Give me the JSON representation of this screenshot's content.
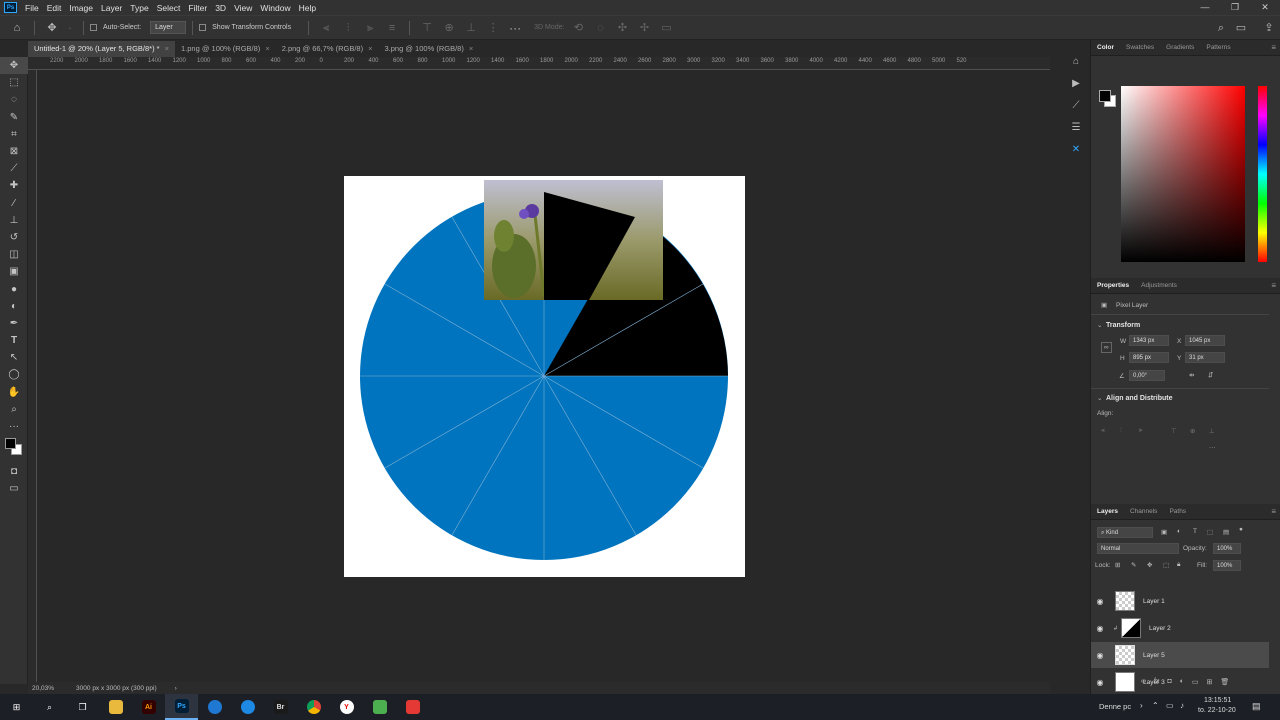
{
  "menu": [
    "File",
    "Edit",
    "Image",
    "Layer",
    "Type",
    "Select",
    "Filter",
    "3D",
    "View",
    "Window",
    "Help"
  ],
  "app_logo": "Ps",
  "window_controls": [
    "—",
    "❐",
    "✕"
  ],
  "options": {
    "auto_select_label": "Auto-Select:",
    "auto_select_value": "Layer",
    "show_transform_label": "Show Transform Controls",
    "mode_3d_label": "3D Mode:"
  },
  "tabs": [
    {
      "label": "Untitled-1 @ 20% (Layer 5, RGB/8*) *",
      "active": true
    },
    {
      "label": "1.png @ 100% (RGB/8)",
      "active": false
    },
    {
      "label": "2.png @ 66,7% (RGB/8)",
      "active": false
    },
    {
      "label": "3.png @ 100% (RGB/8)",
      "active": false
    }
  ],
  "ruler_ticks": [
    "2200",
    "2000",
    "1800",
    "1600",
    "1400",
    "1200",
    "1000",
    "800",
    "600",
    "400",
    "200",
    "0",
    "200",
    "400",
    "600",
    "800",
    "1000",
    "1200",
    "1400",
    "1600",
    "1800",
    "2000",
    "2200",
    "2400",
    "2600",
    "2800",
    "3000",
    "3200",
    "3400",
    "3600",
    "3800",
    "4000",
    "4200",
    "4400",
    "4600",
    "4800",
    "5000",
    "520"
  ],
  "status": {
    "zoom": "20,03%",
    "doc_info": "3000 px x 3000 px (300 ppi)"
  },
  "color_panel": {
    "tabs": [
      "Color",
      "Swatches",
      "Gradients",
      "Patterns"
    ],
    "hue": "#ff0000"
  },
  "properties": {
    "tabs": [
      "Properties",
      "Adjustments"
    ],
    "kind": "Pixel Layer",
    "transform_label": "Transform",
    "w_label": "W",
    "w": "1343 px",
    "h_label": "H",
    "h": "895 px",
    "x_label": "X",
    "x": "1045 px",
    "y_label": "Y",
    "y": "31 px",
    "angle": "0,00°",
    "align_label": "Align and Distribute",
    "align_sub": "Align:"
  },
  "layers_panel": {
    "tabs": [
      "Layers",
      "Channels",
      "Paths"
    ],
    "filter_kind": "Kind",
    "blend": "Normal",
    "opacity_label": "Opacity:",
    "opacity": "100%",
    "lock_label": "Lock:",
    "fill_label": "Fill:",
    "fill": "100%",
    "layers": [
      {
        "name": "Layer 1",
        "selected": false
      },
      {
        "name": "Layer 2",
        "selected": false
      },
      {
        "name": "Layer 5",
        "selected": true
      },
      {
        "name": "Layer 3",
        "selected": false
      }
    ]
  },
  "taskbar": {
    "search_label": "Denne pc",
    "time": "13:15:51",
    "date": "to. 22-10-20",
    "app_labels": [
      "Ai",
      "Ps",
      "Br"
    ]
  },
  "colors": {
    "blue": "#0074be",
    "bg": "#282828",
    "panel": "#323232"
  }
}
